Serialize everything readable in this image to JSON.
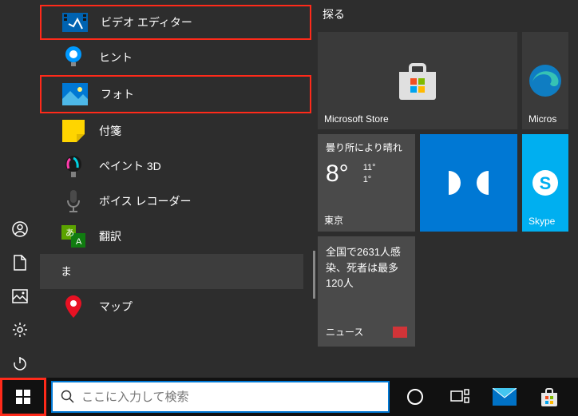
{
  "tiles_header": "探る",
  "left_rail": {
    "account": "アカウント",
    "documents": "ドキュメント",
    "pictures": "ピクチャ",
    "settings": "設定",
    "power": "電源"
  },
  "app_list": [
    {
      "id": "video-editor",
      "label": "ビデオ エディター",
      "highlight": true
    },
    {
      "id": "tips",
      "label": "ヒント",
      "highlight": false
    },
    {
      "id": "photos",
      "label": "フォト",
      "highlight": true
    },
    {
      "id": "sticky-notes",
      "label": "付箋",
      "highlight": false
    },
    {
      "id": "paint3d",
      "label": "ペイント 3D",
      "highlight": false
    },
    {
      "id": "voice-recorder",
      "label": "ボイス レコーダー",
      "highlight": false
    },
    {
      "id": "translator",
      "label": "翻訳",
      "highlight": false
    }
  ],
  "section_letter": "ま",
  "app_list2": [
    {
      "id": "maps",
      "label": "マップ"
    }
  ],
  "tiles": {
    "store": "Microsoft Store",
    "edge_partial": "Micros",
    "skype_partial": "Skype"
  },
  "weather": {
    "condition": "曇り所により晴れ",
    "temp": "8°",
    "hi": "11°",
    "lo": "1°",
    "city": "東京"
  },
  "news": {
    "headline": "全国で2631人感染、死者は最多120人",
    "source": "ニュース"
  },
  "search": {
    "placeholder": "ここに入力して検索"
  }
}
